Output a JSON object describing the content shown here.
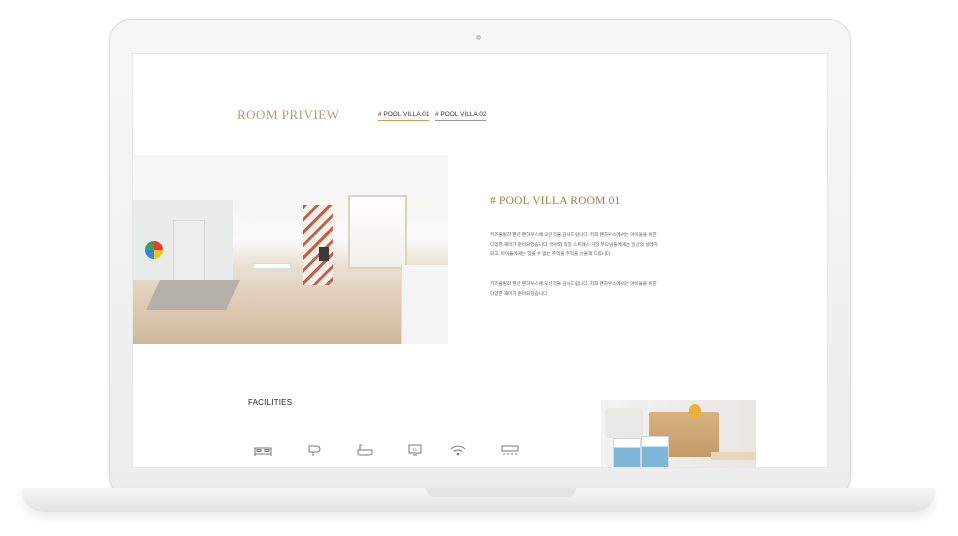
{
  "room_preview": {
    "title": "ROOM PRIVIEW",
    "tabs": [
      {
        "label": "# POOL VILLA  01",
        "active": true
      },
      {
        "label": "# POOL VILLA 02",
        "active": false
      }
    ]
  },
  "room": {
    "heading": "# POOL VILLA ROOM 01",
    "paragraph1": "키즈풀빌라 펜션 팬하우스에 오신것을 감사드립니다. 저희 팬하우스에서는 아이들을 위한 다양한 재미가 준비되었습니다. 유아와 직장 스트레스 가장 부모님들에게는 일상의 설레가 되고, 아이들에게는 잊을 수 없는 추억을 주억을 선물해 드립니다.",
    "paragraph2": "키즈풀빌라 펜션 팬하우스에 오신것을 감사드립니다. 저희 팬하우스에서는 아이들을 위한 다양한 재미가 준비되었습니다."
  },
  "facilities": {
    "title": "FACILITIES",
    "icons": [
      "bed-icon",
      "hair-dryer-icon",
      "bathtub-icon",
      "tv-icon",
      "wifi-icon",
      "air-conditioner-icon"
    ],
    "tv_label": "TV"
  },
  "colors": {
    "accent_gold": "#a87b3d",
    "title_tan": "#b39a78",
    "tab_underline": "#c59a5a"
  }
}
